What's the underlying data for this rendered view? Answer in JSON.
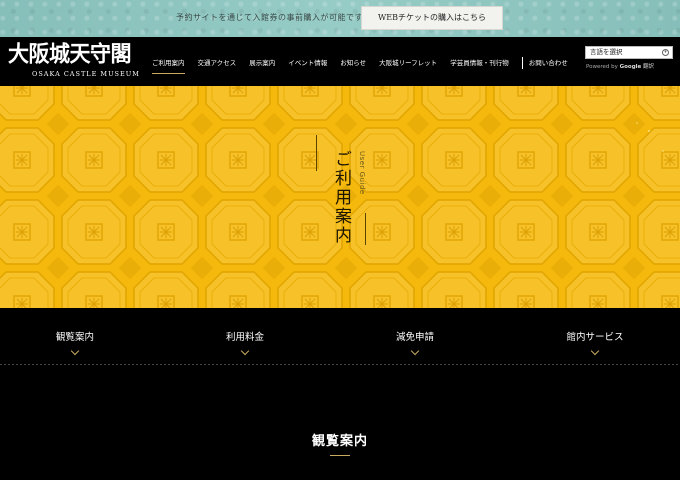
{
  "topbar": {
    "notice": "予約サイトを通じて入館券の事前購入が可能です。",
    "ticket_button": "WEBチケットの購入はこちら"
  },
  "header": {
    "logo_jp": "大阪城天守閣",
    "logo_en": "OSAKA CASTLE MUSEUM",
    "nav": [
      {
        "label": "ご利用案内",
        "active": true
      },
      {
        "label": "交通アクセス"
      },
      {
        "label": "展示案内"
      },
      {
        "label": "イベント情報"
      },
      {
        "label": "お知らせ"
      },
      {
        "label": "大阪城リーフレット"
      },
      {
        "label": "学芸員情報・刊行物"
      },
      {
        "label": "お問い合わせ"
      }
    ],
    "language": {
      "placeholder": "言語を選択",
      "powered_by": "Powered by",
      "google": "Google",
      "translate": "翻訳"
    }
  },
  "hero": {
    "title": "ご利用案内",
    "subtitle": "User Guide",
    "background_color": "#f5b80c"
  },
  "subnav": [
    {
      "label": "観覧案内",
      "icon": "chevron-down-icon"
    },
    {
      "label": "利用料金",
      "icon": "chevron-down-icon"
    },
    {
      "label": "減免申請",
      "icon": "chevron-down-icon"
    },
    {
      "label": "館内サービス",
      "icon": "chevron-down-icon"
    }
  ],
  "section": {
    "title": "観覧案内"
  },
  "colors": {
    "accent_gold": "#c8a95e",
    "topbar_teal": "#8fc6c1"
  }
}
